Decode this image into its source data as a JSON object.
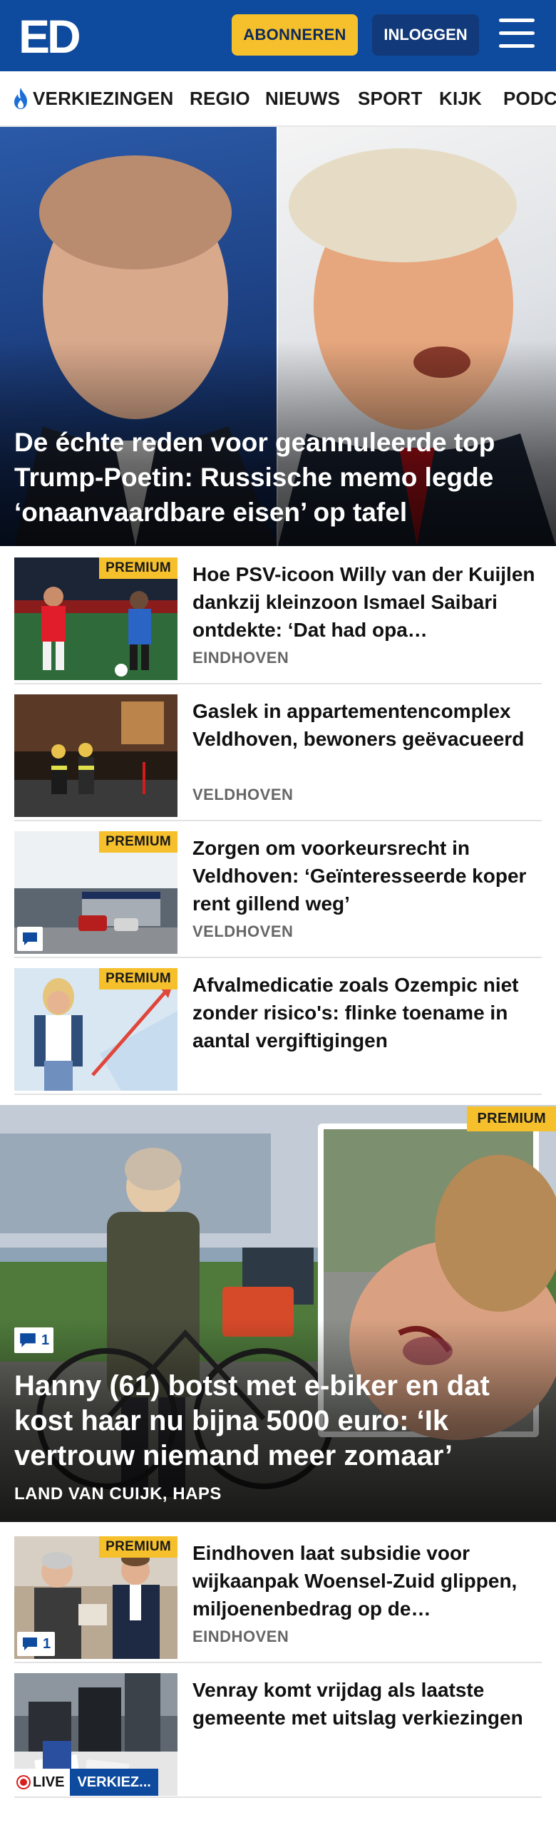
{
  "header": {
    "logo_text": "ED",
    "subscribe_label": "ABONNEREN",
    "login_label": "INLOGGEN"
  },
  "nav": {
    "items": [
      "VERKIEZINGEN",
      "REGIO",
      "NIEUWS",
      "SPORT",
      "KIJK",
      "PODC"
    ]
  },
  "hero": {
    "title": "De échte reden voor geannuleerde top Trump-Poetin: Russische memo legde ‘onaanvaardbare eisen’ op tafel"
  },
  "articles": [
    {
      "title": "Hoe PSV-icoon Willy van der Kuijlen dankzij kleinzoon Ismael Saibari ontdekte: ‘Dat had opa…",
      "location": "EINDHOVEN",
      "premium": "PREMIUM"
    },
    {
      "title": "Gaslek in appartementencom­plex Veldhoven, bewoners geëvacueerd",
      "location": "VELDHOVEN"
    },
    {
      "title": "Zorgen om voorkeursrecht in Veldhoven: ‘Geïnteresseerde koper rent gillend weg’",
      "location": "VELDHOVEN",
      "premium": "PREMIUM"
    },
    {
      "title": "Afvalmedicatie zoals Ozempic niet zonder risico's: flinke toename in aantal vergiftigingen",
      "premium": "PREMIUM"
    }
  ],
  "featured": {
    "premium": "PREMIUM",
    "comments": "1",
    "title": "Hanny (61) botst met e-biker en dat kost haar nu bijna 5000 euro: ‘Ik vertrouw niemand meer zomaar’",
    "location": "LAND VAN CUIJK, HAPS"
  },
  "articles2": [
    {
      "title": "Eindhoven laat subsidie voor wijkaanpak Woensel-Zuid glippen, miljoenenbedrag op de…",
      "location": "EINDHOVEN",
      "premium": "PREMIUM",
      "comments": "1"
    },
    {
      "title": "Venray komt vrijdag als laatste gemeente met uitslag verkiezin­gen",
      "live": "LIVE",
      "tag": "VERKIEZ..."
    }
  ],
  "colors": {
    "brand_blue": "#0e4a9d",
    "premium_yellow": "#f5c02b",
    "live_red": "#d81e1e"
  }
}
